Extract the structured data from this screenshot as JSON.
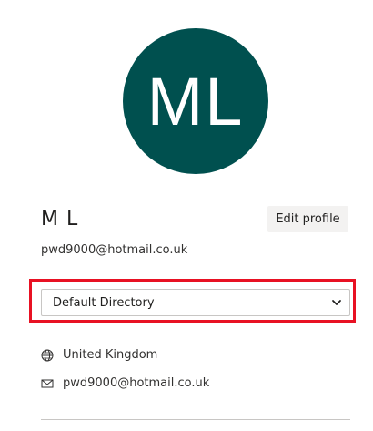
{
  "profile": {
    "initials": "ML",
    "display_name": "M L",
    "email": "pwd9000@hotmail.co.uk",
    "edit_label": "Edit profile",
    "avatar_color": "#00504f"
  },
  "directory_select": {
    "selected": "Default Directory"
  },
  "details": {
    "country": "United Kingdom",
    "contact_email": "pwd9000@hotmail.co.uk"
  },
  "icons": {
    "country": "globe-icon",
    "email": "mail-icon",
    "select": "chevron-down-icon"
  },
  "colors": {
    "highlight": "#e81123",
    "button_bg": "#f3f2f1"
  }
}
